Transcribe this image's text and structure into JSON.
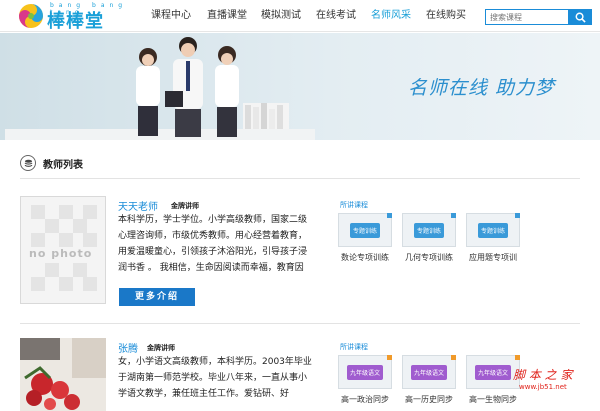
{
  "header": {
    "logo_text": "棒棒堂",
    "logo_pinyin": "bang bang tang",
    "nav": [
      {
        "label": "课程中心",
        "active": false
      },
      {
        "label": "直播课堂",
        "active": false
      },
      {
        "label": "模拟测试",
        "active": false
      },
      {
        "label": "在线考试",
        "active": false
      },
      {
        "label": "名师风采",
        "active": true
      },
      {
        "label": "在线购买",
        "active": false
      }
    ],
    "search_placeholder": "搜索课程",
    "search_icon": "search-icon"
  },
  "banner": {
    "slogan": "名师在线   助力梦"
  },
  "section": {
    "title": "教师列表",
    "icon": "stack-icon"
  },
  "teachers": [
    {
      "name": "天天老师",
      "badge": "金牌讲师",
      "photo_text": "no photo",
      "bio": "本科学历，学士学位。小学高级教师，国家二级心理咨询师，市级优秀教师。用心经营着教育，用爱温暖童心，引领孩子沐浴阳光，引导孩子浸润书香 。 我相信，生命因阅读而幸福，教育因",
      "more_label": "更多介绍",
      "courses_label": "所讲课程",
      "courses": [
        {
          "thumb": "专题训练",
          "title": "数论专项训练"
        },
        {
          "thumb": "专题训练",
          "title": "几何专项训练"
        },
        {
          "thumb": "专题训练",
          "title": "应用题专项训"
        }
      ]
    },
    {
      "name": "张腾",
      "badge": "金牌讲师",
      "bio": "女，小学语文高级教师，本科学历。2003年毕业于湖南第一师范学校。毕业八年来，一直从事小学语文教学，兼任班主任工作。爱钻研、好",
      "courses_label": "所讲课程",
      "courses": [
        {
          "thumb": "九年级语文",
          "title": "高一政治同步"
        },
        {
          "thumb": "九年级语文",
          "title": "高一历史同步"
        },
        {
          "thumb": "九年级语文",
          "title": "高一生物同步"
        }
      ]
    }
  ],
  "watermark": {
    "title": "脚 本 之 家",
    "url": "www.jb51.net"
  },
  "colors": {
    "brand": "#1aa0d8",
    "button": "#1a78c8",
    "chip_blue": "#3a9ad9",
    "chip_purple": "#a05ccf",
    "corner_orange": "#f09a2a",
    "watermark": "#e0241c"
  }
}
